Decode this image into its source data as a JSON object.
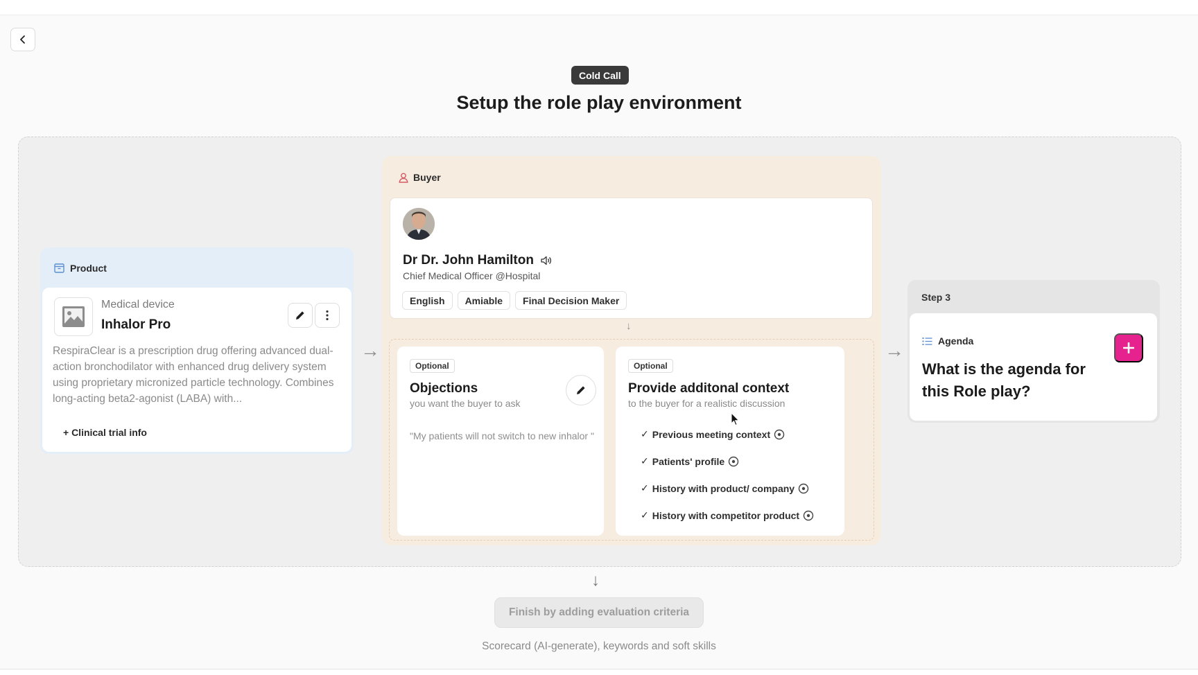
{
  "header": {
    "badge": "Cold Call",
    "title": "Setup the role play environment"
  },
  "product": {
    "section_label": "Product",
    "category": "Medical device",
    "name": "Inhalor Pro",
    "description": "RespiraClear is a prescription drug offering advanced dual-action bronchodilator with enhanced drug delivery system using proprietary micronized particle technology. Combines long-acting beta2-agonist (LABA) with...",
    "link_label": "+ Clinical trial info"
  },
  "buyer": {
    "section_label": "Buyer",
    "name": "Dr Dr. John Hamilton",
    "role": "Chief Medical Officer @Hospital",
    "tags": [
      "English",
      "Amiable",
      "Final Decision Maker"
    ]
  },
  "objections": {
    "badge": "Optional",
    "title": "Objections",
    "subtitle": "you want the buyer to ask",
    "example": "\"My patients will not switch to new inhalor \""
  },
  "context": {
    "badge": "Optional",
    "title": "Provide additonal context",
    "subtitle": "to the buyer for a realistic discussion",
    "items": [
      "Previous meeting context",
      "Patients' profile",
      "History with product/ company",
      "History with competitor product"
    ]
  },
  "step3": {
    "label": "Step 3",
    "section_label": "Agenda",
    "question": "What is the agenda for this Role play?"
  },
  "footer": {
    "finish_button": "Finish by adding evaluation criteria",
    "note": "Scorecard (AI-generate), keywords and soft skills"
  },
  "colors": {
    "accent": "#e6228f",
    "product_bg": "#e3eef8",
    "buyer_bg": "#f7ece0"
  }
}
